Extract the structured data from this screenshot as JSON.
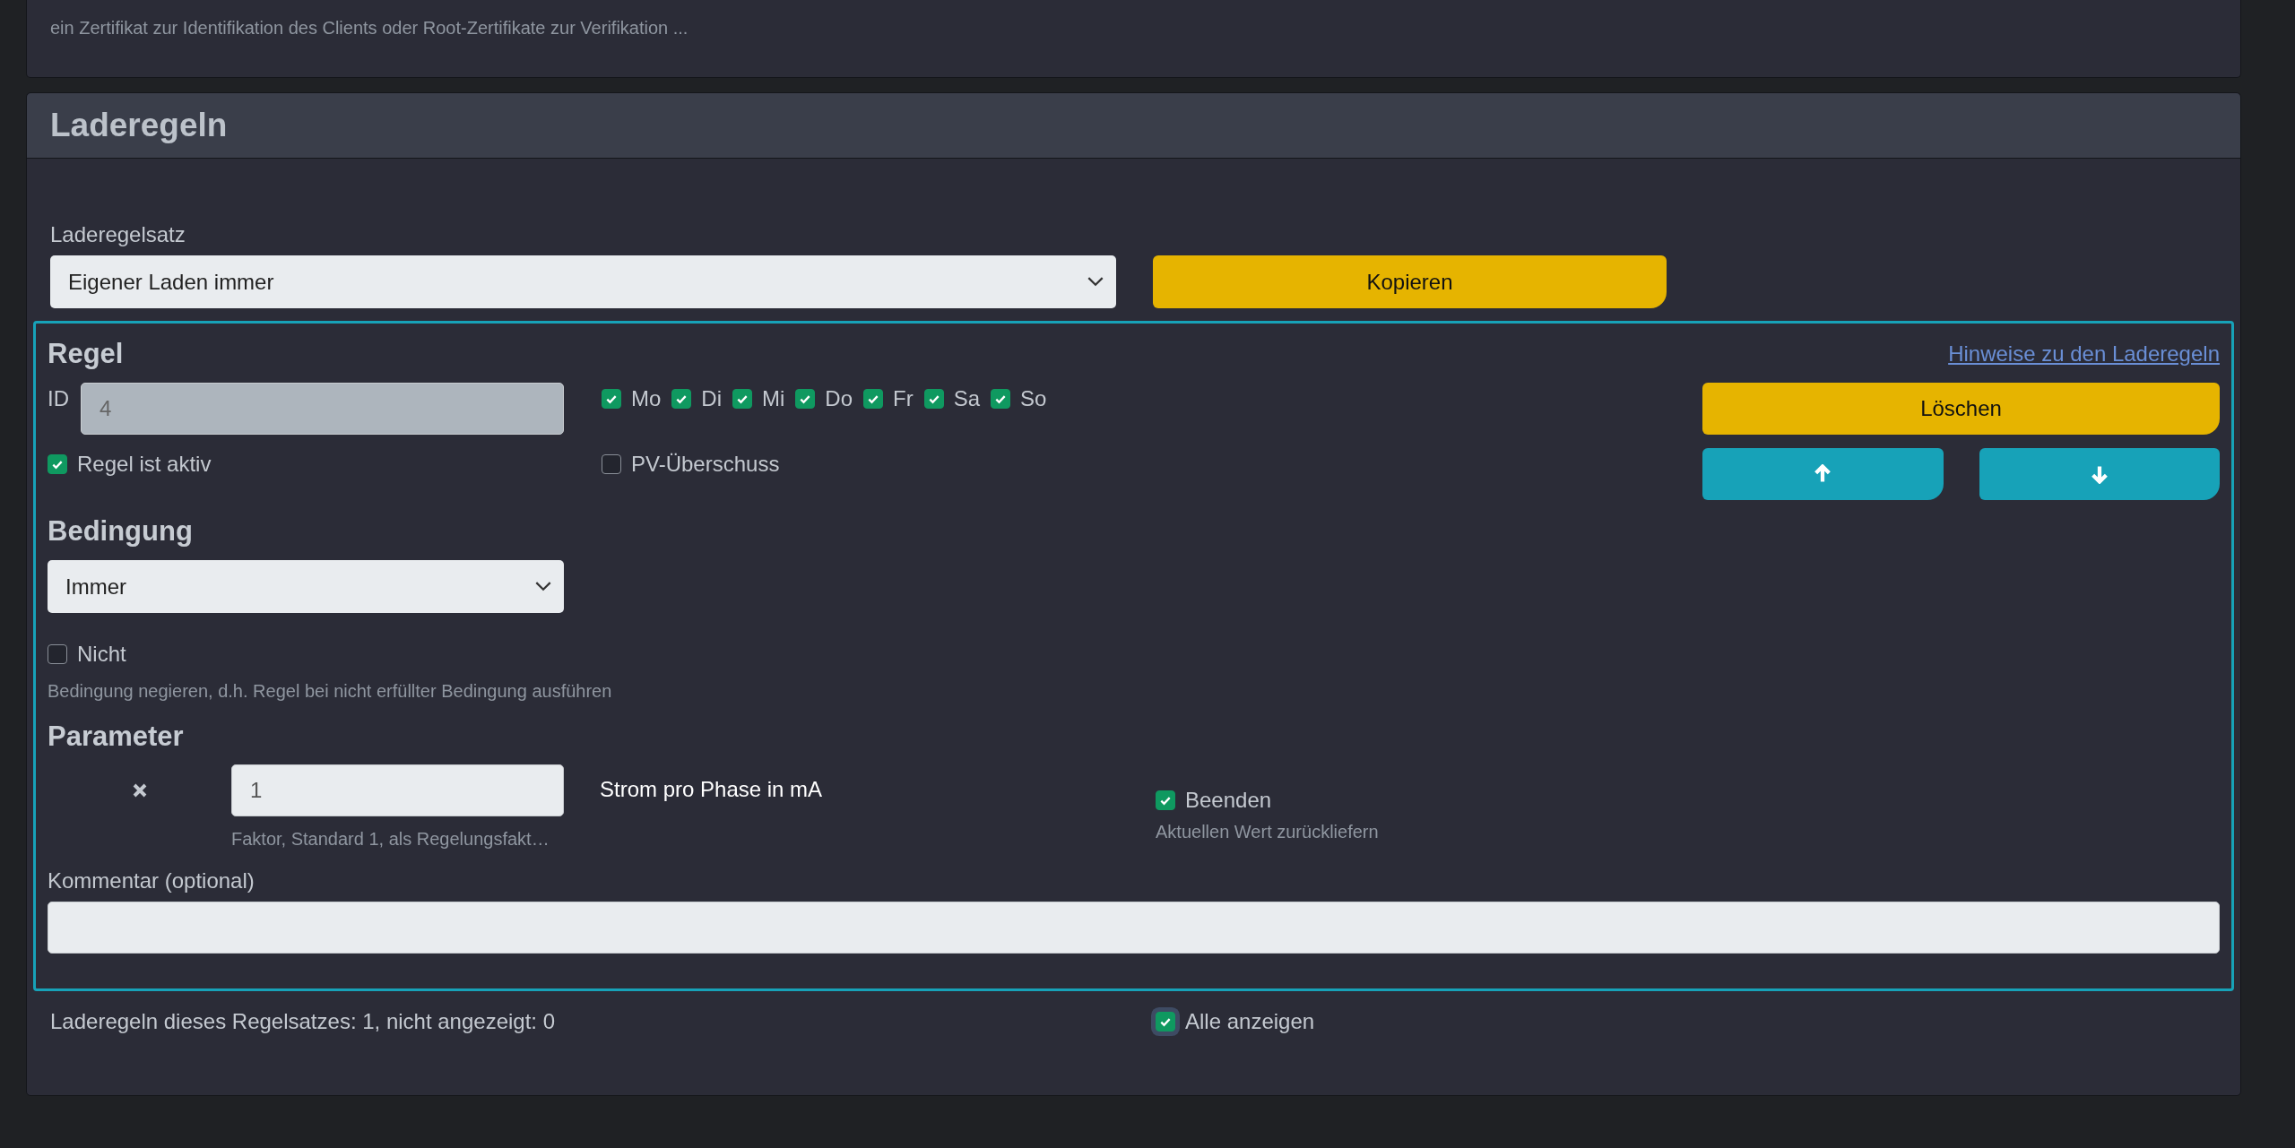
{
  "top_card": {
    "hint": "ein Zertifikat zur Identifikation des Clients oder Root-Zertifikate zur Verifikation ..."
  },
  "panel": {
    "title": "Laderegeln"
  },
  "ruleset": {
    "label": "Laderegelsatz",
    "value": "Eigener Laden immer",
    "copy_button": "Kopieren"
  },
  "rule": {
    "heading": "Regel",
    "help_link": "Hinweise zu den Laderegeln",
    "id_label": "ID",
    "id_value": "4",
    "days": [
      {
        "label": "Mo",
        "checked": true
      },
      {
        "label": "Di",
        "checked": true
      },
      {
        "label": "Mi",
        "checked": true
      },
      {
        "label": "Do",
        "checked": true
      },
      {
        "label": "Fr",
        "checked": true
      },
      {
        "label": "Sa",
        "checked": true
      },
      {
        "label": "So",
        "checked": true
      }
    ],
    "active": {
      "label": "Regel ist aktiv",
      "checked": true
    },
    "pv_surplus": {
      "label": "PV-Überschuss",
      "checked": false
    },
    "delete_button": "Löschen",
    "condition": {
      "heading": "Bedingung",
      "value": "Immer",
      "negate": {
        "label": "Nicht",
        "checked": false
      },
      "hint": "Bedingung negieren, d.h. Regel bei nicht erfüllter Bedingung ausführen"
    },
    "parameter": {
      "heading": "Parameter",
      "value": "1",
      "hint": "Faktor, Standard 1, als Regelungsfakt…",
      "name": "Strom pro Phase in mA",
      "finish": {
        "label": "Beenden",
        "checked": true
      },
      "finish_hint": "Aktuellen Wert zurückliefern"
    },
    "comment": {
      "label": "Kommentar (optional)"
    }
  },
  "footer": {
    "summary": "Laderegeln dieses Regelsatzes: 1, nicht angezeigt: 0",
    "show_all": {
      "label": "Alle anzeigen",
      "checked": true
    }
  }
}
